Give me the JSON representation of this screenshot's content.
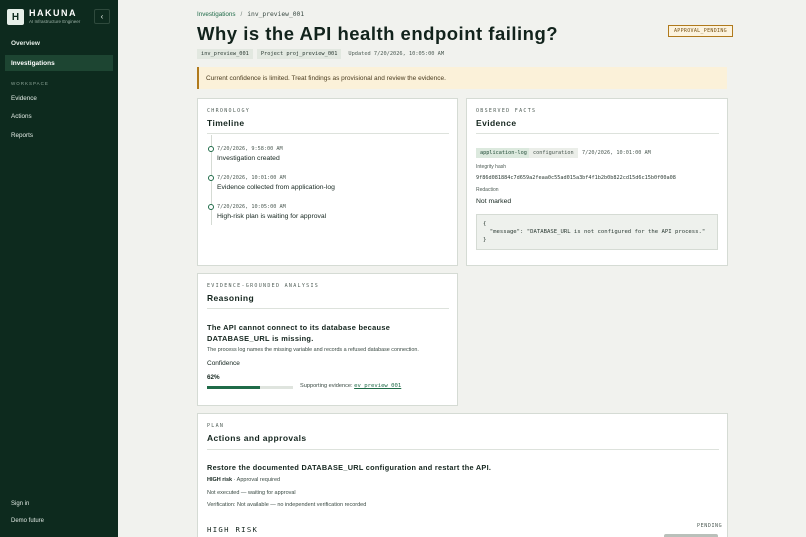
{
  "brand": {
    "mark": "H",
    "name": "HAKUNA",
    "subtitle": "AI Infrastructure Engineer",
    "collapse_icon": "chevron-left-icon"
  },
  "sidebar": {
    "items": [
      {
        "label": "Overview"
      },
      {
        "label": "Investigations",
        "active": true
      }
    ],
    "section_label": "WORKSPACE",
    "workspace_items": [
      {
        "label": "Evidence"
      },
      {
        "label": "Actions"
      },
      {
        "label": "Reports"
      }
    ],
    "sign_in": "Sign in",
    "demo": "Demo future"
  },
  "breadcrumb": {
    "parent": "Investigations",
    "separator": "/",
    "current": "inv_preview_001"
  },
  "page": {
    "title": "Why is the API health endpoint failing?",
    "status": "APPROVAL_PENDING",
    "id_chip": "inv_preview_001",
    "project_chip": "Project proj_preview_001",
    "updated": "Updated 7/20/2026, 10:05:00 AM"
  },
  "notice": "Current confidence is limited. Treat findings as provisional and review the evidence.",
  "timeline": {
    "eyebrow": "CHRONOLOGY",
    "title": "Timeline",
    "events": [
      {
        "time": "7/20/2026, 9:58:00 AM",
        "label": "Investigation created"
      },
      {
        "time": "7/20/2026, 10:01:00 AM",
        "label": "Evidence collected from application-log"
      },
      {
        "time": "7/20/2026, 10:05:00 AM",
        "label": "High-risk plan is waiting for approval"
      }
    ]
  },
  "evidence": {
    "eyebrow": "OBSERVED FACTS",
    "title": "Evidence",
    "source_chip": "application-log",
    "type_chip": "configuration",
    "time": "7/20/2026, 10:01:00 AM",
    "hash_label": "Integrity hash",
    "hash": "9f86d081884c7d659a2feaa0c55ad015a3bf4f1b2b0b822cd15d6c15b0f00a08",
    "redaction_label": "Redaction",
    "redaction_value": "Not marked",
    "code": "{\n  \"message\": \"DATABASE_URL is not configured for the API process.\"\n}"
  },
  "reasoning": {
    "eyebrow": "EVIDENCE-GROUNDED ANALYSIS",
    "title": "Reasoning",
    "headline": "The API cannot connect to its database because DATABASE_URL is missing.",
    "body": "The process log names the missing variable and records a refused database connection.",
    "confidence_label": "Confidence",
    "confidence_value": "62%",
    "confidence_fraction": 0.62,
    "support_label": "Supporting evidence:",
    "support_link": "ev_preview_001"
  },
  "plan": {
    "eyebrow": "PLAN",
    "title": "Actions and approvals",
    "headline": "Restore the documented DATABASE_URL configuration and restart the API.",
    "risk_label": "HIGH risk",
    "risk_rest": " · Approval required",
    "execution": "Not executed — waiting for approval",
    "verification": "Verification: Not available — no independent verification recorded",
    "risk_big": "HIGH RISK",
    "pending": "PENDING"
  }
}
